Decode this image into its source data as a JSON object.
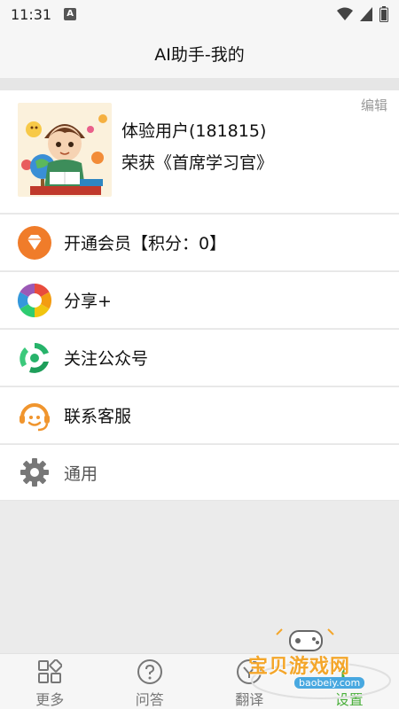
{
  "status_bar": {
    "time": "11:31",
    "notif_icon": "a-icon"
  },
  "app_bar": {
    "title": "AI助手-我的"
  },
  "profile": {
    "edit_label": "编辑",
    "user_name": "体验用户(181815)",
    "honor": "荣获《首席学习官》"
  },
  "menu": [
    {
      "label": "开通会员【积分：0】",
      "icon": "diamond-icon",
      "color": "#f07c2a"
    },
    {
      "label": "分享+",
      "icon": "aperture-icon",
      "color": "#3fa2e8"
    },
    {
      "label": "关注公众号",
      "icon": "recycle-icon",
      "color": "#27b36a"
    },
    {
      "label": "联系客服",
      "icon": "customer-service-icon",
      "color": "#f0952e"
    },
    {
      "label": "通用",
      "icon": "gear-icon",
      "color": "#777777"
    }
  ],
  "bottom_nav": [
    {
      "label": "更多",
      "icon": "grid-icon"
    },
    {
      "label": "问答",
      "icon": "question-icon"
    },
    {
      "label": "翻译",
      "icon": "translate-icon"
    },
    {
      "label": "设置",
      "icon": "settings-icon",
      "active": true
    }
  ],
  "watermark": {
    "text": "宝贝游戏网",
    "url": "baobeiy.com"
  },
  "colors": {
    "accent": "#4aaf3b",
    "background": "#ebebeb"
  }
}
